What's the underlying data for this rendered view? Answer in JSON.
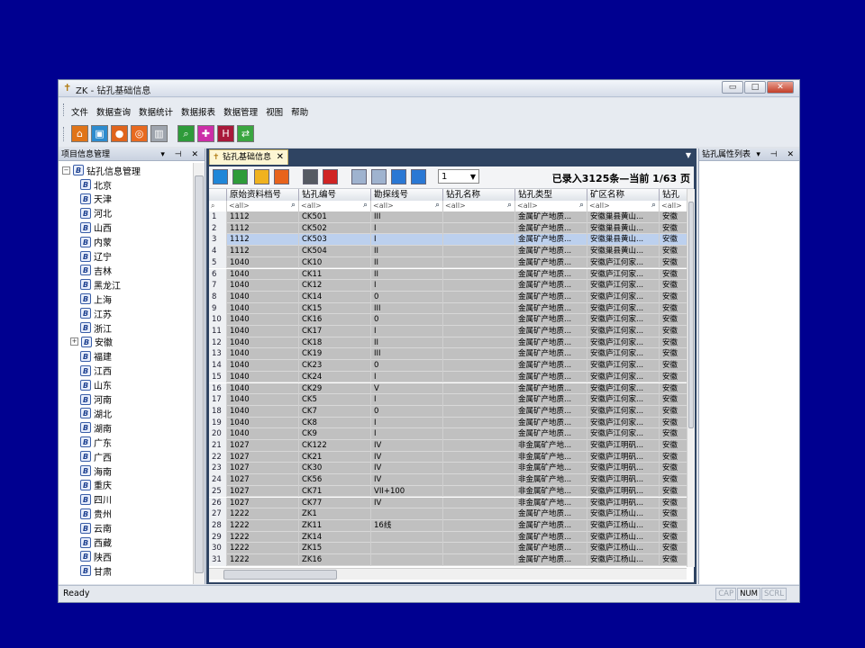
{
  "window": {
    "title": "ZK - 钻孔基础信息",
    "buttons": [
      "▭",
      "□",
      "✕"
    ]
  },
  "menu": [
    "文件",
    "数据查询",
    "数据统计",
    "数据报表",
    "数据管理",
    "视图",
    "帮助"
  ],
  "toolbar_icons": [
    {
      "name": "home-icon",
      "color": "#e07418",
      "glyph": "⌂"
    },
    {
      "name": "briefcase-icon",
      "color": "#2d8ccf",
      "glyph": "▣"
    },
    {
      "name": "location-pin-icon",
      "color": "#e0641c",
      "glyph": "●"
    },
    {
      "name": "lifebuoy-icon",
      "color": "#e86a20",
      "glyph": "◎"
    },
    {
      "name": "bar-chart-icon",
      "color": "#9ea4ad",
      "glyph": "▥"
    },
    {
      "name": "search-icon",
      "color": "#2e9b3a",
      "glyph": "⌕"
    },
    {
      "name": "puzzle-icon",
      "color": "#cc2ea8",
      "glyph": "✚"
    },
    {
      "name": "save-icon",
      "color": "#a8183a",
      "glyph": "H"
    },
    {
      "name": "exchange-icon",
      "color": "#3aa640",
      "glyph": "⇄"
    }
  ],
  "left_panel": {
    "title": "项目信息管理",
    "controls": "▾ ⊣ ✕",
    "root": "钻孔信息管理",
    "items": [
      "北京",
      "天津",
      "河北",
      "山西",
      "内蒙",
      "辽宁",
      "吉林",
      "黑龙江",
      "上海",
      "江苏",
      "浙江",
      "安徽",
      "福建",
      "江西",
      "山东",
      "河南",
      "湖北",
      "湖南",
      "广东",
      "广西",
      "海南",
      "重庆",
      "四川",
      "贵州",
      "云南",
      "西藏",
      "陕西",
      "甘肃"
    ],
    "expanded_item": "安徽"
  },
  "doc_tab": {
    "label": "钻孔基础信息",
    "close": "✕"
  },
  "grid_toolbar": {
    "icons": [
      {
        "name": "document-icon",
        "color": "#1f86d8"
      },
      {
        "name": "database-icon",
        "color": "#2e9b3a"
      },
      {
        "name": "delete-icon",
        "color": "#f0b21e"
      },
      {
        "name": "refresh-icon",
        "color": "#e8631c"
      },
      {
        "name": "settings-icon",
        "color": "#555a62"
      },
      {
        "name": "print-icon",
        "color": "#d02424"
      },
      {
        "name": "first-page-icon",
        "color": "#9fb3cf"
      },
      {
        "name": "prev-page-icon",
        "color": "#9fb3cf"
      },
      {
        "name": "next-page-icon",
        "color": "#2a78d4"
      },
      {
        "name": "last-page-icon",
        "color": "#2a78d4"
      }
    ],
    "page_value": "1",
    "status": "已录入3125条—当前 1/63 页"
  },
  "grid": {
    "columns": [
      "原始资料档号",
      "钻孔编号",
      "勘探线号",
      "钻孔名称",
      "钻孔类型",
      "矿区名称",
      "钻孔"
    ],
    "filter_placeholder": "<all>",
    "selected_row": 3,
    "rows": [
      [
        "1",
        "1112",
        "CK501",
        "III",
        "",
        "金属矿产地质...",
        "安徽巢县黄山...",
        "安徽"
      ],
      [
        "2",
        "1112",
        "CK502",
        "I",
        "",
        "金属矿产地质...",
        "安徽巢县黄山...",
        "安徽"
      ],
      [
        "3",
        "1112",
        "CK503",
        "I",
        "",
        "金属矿产地质...",
        "安徽巢县黄山...",
        "安徽"
      ],
      [
        "4",
        "1112",
        "CK504",
        "II",
        "",
        "金属矿产地质...",
        "安徽巢县黄山...",
        "安徽"
      ],
      [
        "5",
        "1040",
        "CK10",
        "II",
        "",
        "金属矿产地质...",
        "安徽庐江何家...",
        "安徽"
      ],
      [
        "6",
        "1040",
        "CK11",
        "II",
        "",
        "金属矿产地质...",
        "安徽庐江何家...",
        "安徽"
      ],
      [
        "7",
        "1040",
        "CK12",
        "I",
        "",
        "金属矿产地质...",
        "安徽庐江何家...",
        "安徽"
      ],
      [
        "8",
        "1040",
        "CK14",
        "0",
        "",
        "金属矿产地质...",
        "安徽庐江何家...",
        "安徽"
      ],
      [
        "9",
        "1040",
        "CK15",
        "III",
        "",
        "金属矿产地质...",
        "安徽庐江何家...",
        "安徽"
      ],
      [
        "10",
        "1040",
        "CK16",
        "0",
        "",
        "金属矿产地质...",
        "安徽庐江何家...",
        "安徽"
      ],
      [
        "11",
        "1040",
        "CK17",
        "I",
        "",
        "金属矿产地质...",
        "安徽庐江何家...",
        "安徽"
      ],
      [
        "12",
        "1040",
        "CK18",
        "II",
        "",
        "金属矿产地质...",
        "安徽庐江何家...",
        "安徽"
      ],
      [
        "13",
        "1040",
        "CK19",
        "III",
        "",
        "金属矿产地质...",
        "安徽庐江何家...",
        "安徽"
      ],
      [
        "14",
        "1040",
        "CK23",
        "0",
        "",
        "金属矿产地质...",
        "安徽庐江何家...",
        "安徽"
      ],
      [
        "15",
        "1040",
        "CK24",
        "I",
        "",
        "金属矿产地质...",
        "安徽庐江何家...",
        "安徽"
      ],
      [
        "16",
        "1040",
        "CK29",
        "V",
        "",
        "金属矿产地质...",
        "安徽庐江何家...",
        "安徽"
      ],
      [
        "17",
        "1040",
        "CK5",
        "I",
        "",
        "金属矿产地质...",
        "安徽庐江何家...",
        "安徽"
      ],
      [
        "18",
        "1040",
        "CK7",
        "0",
        "",
        "金属矿产地质...",
        "安徽庐江何家...",
        "安徽"
      ],
      [
        "19",
        "1040",
        "CK8",
        "I",
        "",
        "金属矿产地质...",
        "安徽庐江何家...",
        "安徽"
      ],
      [
        "20",
        "1040",
        "CK9",
        "I",
        "",
        "金属矿产地质...",
        "安徽庐江何家...",
        "安徽"
      ],
      [
        "21",
        "1027",
        "CK122",
        "IV",
        "",
        "非金属矿产地...",
        "安徽庐江明矾...",
        "安徽"
      ],
      [
        "22",
        "1027",
        "CK21",
        "IV",
        "",
        "非金属矿产地...",
        "安徽庐江明矾...",
        "安徽"
      ],
      [
        "23",
        "1027",
        "CK30",
        "IV",
        "",
        "非金属矿产地...",
        "安徽庐江明矾...",
        "安徽"
      ],
      [
        "24",
        "1027",
        "CK56",
        "IV",
        "",
        "非金属矿产地...",
        "安徽庐江明矾...",
        "安徽"
      ],
      [
        "25",
        "1027",
        "CK71",
        "VII+100",
        "",
        "非金属矿产地...",
        "安徽庐江明矾...",
        "安徽"
      ],
      [
        "26",
        "1027",
        "CK77",
        "IV",
        "",
        "非金属矿产地...",
        "安徽庐江明矾...",
        "安徽"
      ],
      [
        "27",
        "1222",
        "ZK1",
        "",
        "",
        "金属矿产地质...",
        "安徽庐江杨山...",
        "安徽"
      ],
      [
        "28",
        "1222",
        "ZK11",
        "16线",
        "",
        "金属矿产地质...",
        "安徽庐江杨山...",
        "安徽"
      ],
      [
        "29",
        "1222",
        "ZK14",
        "",
        "",
        "金属矿产地质...",
        "安徽庐江杨山...",
        "安徽"
      ],
      [
        "30",
        "1222",
        "ZK15",
        "",
        "",
        "金属矿产地质...",
        "安徽庐江杨山...",
        "安徽"
      ],
      [
        "31",
        "1222",
        "ZK16",
        "",
        "",
        "金属矿产地质...",
        "安徽庐江杨山...",
        "安徽"
      ]
    ]
  },
  "right_panel": {
    "title": "钻孔属性列表",
    "controls": "▾ ⊣ ✕"
  },
  "statusbar": {
    "ready": "Ready",
    "keys": [
      "CAP",
      "NUM",
      "SCRL"
    ]
  }
}
